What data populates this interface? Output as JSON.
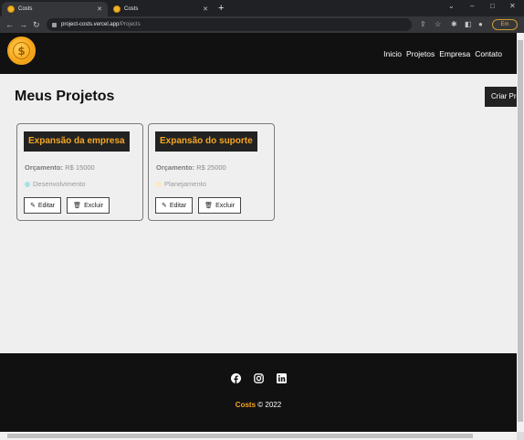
{
  "browser": {
    "tabs": [
      {
        "title": "Costs",
        "active": true
      },
      {
        "title": "Costs",
        "active": false
      }
    ],
    "url_host": "project-costs.vercel.app",
    "url_path": "/Projects",
    "profile_label": "Em"
  },
  "nav": {
    "links": [
      "Inicio",
      "Projetos",
      "Empresa",
      "Contato"
    ]
  },
  "page": {
    "title": "Meus Projetos",
    "create_button": "Criar Projeto"
  },
  "projects": [
    {
      "name": "Expansão da empresa",
      "budget_label": "Orçamento:",
      "budget_value": "R$ 15000",
      "category": "Desenvolvimento",
      "category_color": "#a7e1e6",
      "edit_label": "Editar",
      "delete_label": "Excluir"
    },
    {
      "name": "Expansão do suporte",
      "budget_label": "Orçamento:",
      "budget_value": "R$ 25000",
      "category": "Planejamento",
      "category_color": "#fde8bf",
      "edit_label": "Editar",
      "delete_label": "Excluir"
    }
  ],
  "footer": {
    "social_icons": [
      "facebook-icon",
      "instagram-icon",
      "linkedin-icon"
    ],
    "brand": "Costs",
    "copyright": "© 2022"
  },
  "colors": {
    "accent": "#f6a622",
    "dark": "#111111",
    "background": "#efefef"
  }
}
